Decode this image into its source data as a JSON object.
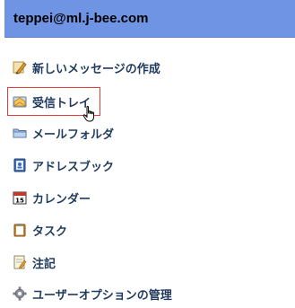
{
  "account": {
    "email": "teppei@ml.j-bee.com"
  },
  "menu": {
    "items": [
      {
        "label": "新しいメッセージの作成",
        "icon": "compose-pencil-icon"
      },
      {
        "label": "受信トレイ",
        "icon": "inbox-envelope-icon",
        "selected": true
      },
      {
        "label": "メールフォルダ",
        "icon": "folder-icon"
      },
      {
        "label": "アドレスブック",
        "icon": "address-book-icon"
      },
      {
        "label": "カレンダー",
        "icon": "calendar-icon",
        "calendar_day": "15"
      },
      {
        "label": "タスク",
        "icon": "task-clipboard-icon"
      },
      {
        "label": "注記",
        "icon": "note-icon"
      },
      {
        "label": "ユーザーオプションの管理",
        "icon": "gear-icon"
      }
    ]
  },
  "colors": {
    "header_bg": "#6f94e4",
    "label_text": "#1f3a5c",
    "selection_border": "#e23b3b"
  }
}
